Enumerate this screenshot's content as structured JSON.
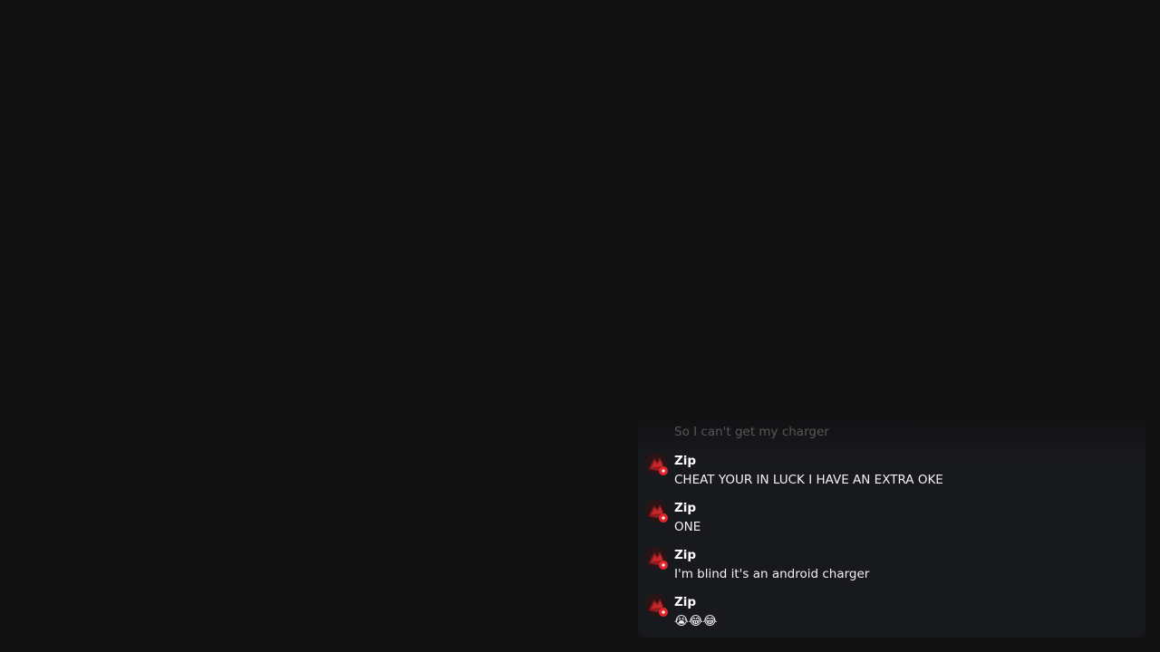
{
  "chat": {
    "faded_previous": "So I can't get my charger",
    "messages": [
      {
        "username": "Zip",
        "text": "CHEAT YOUR IN LUCK I HAVE AN EXTRA OKE",
        "avatar_icon": "user-avatar-red"
      },
      {
        "username": "Zip",
        "text": "ONE",
        "avatar_icon": "user-avatar-red"
      },
      {
        "username": "Zip",
        "text": "I'm blind it's an android charger",
        "avatar_icon": "user-avatar-red"
      },
      {
        "username": "Zip",
        "text": "😭😂😂",
        "avatar_icon": "user-avatar-red"
      }
    ]
  },
  "colors": {
    "background": "#111112",
    "panel": "#18191d",
    "avatar_accent": "#d6262b"
  }
}
